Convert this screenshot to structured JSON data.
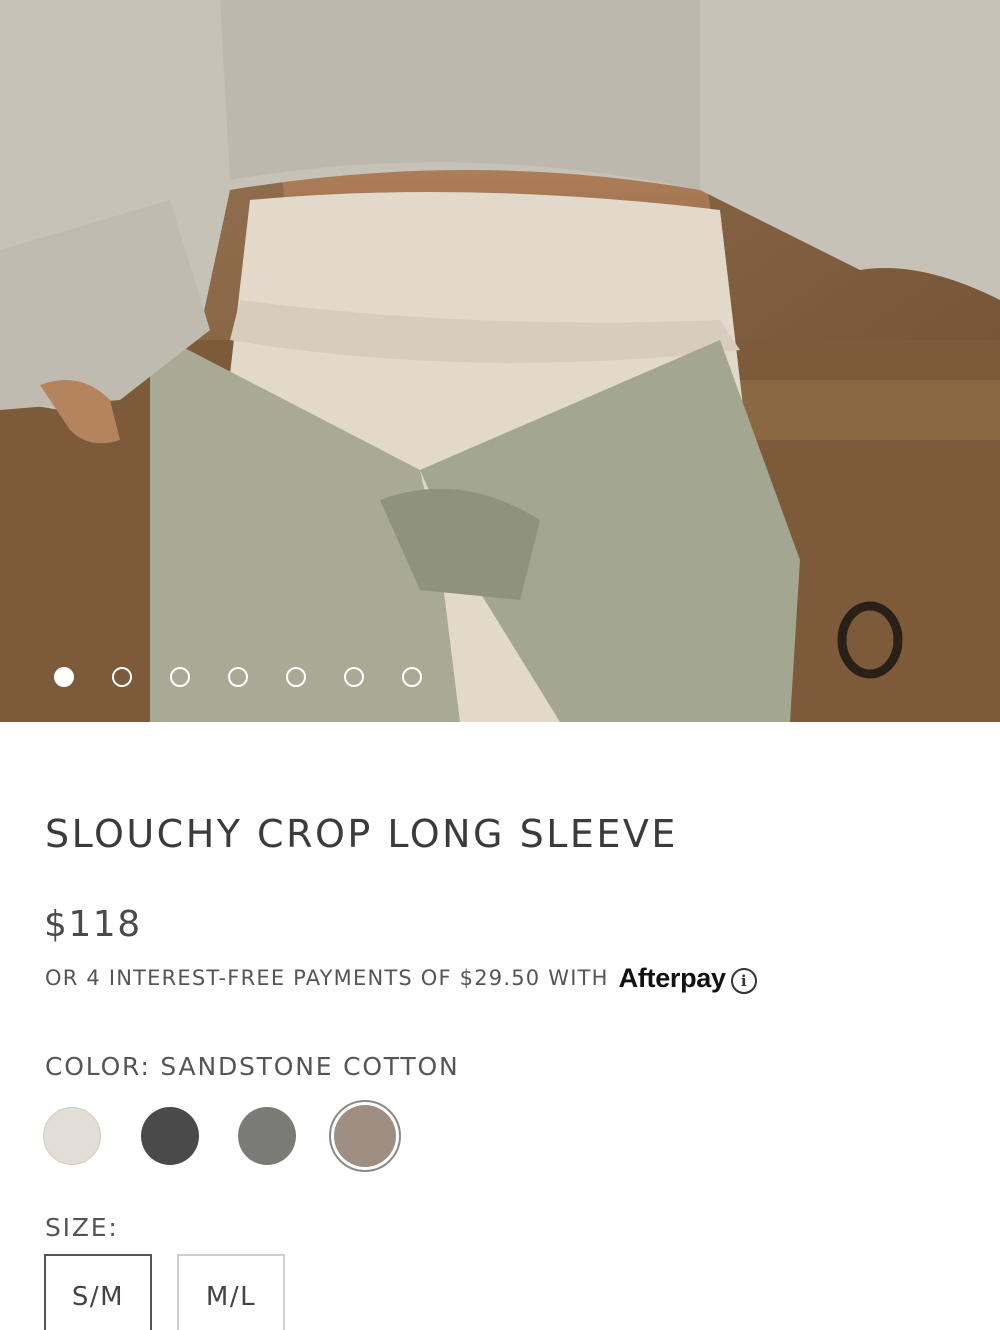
{
  "gallery": {
    "image_alt": "Model wearing slouchy crop long sleeve with leggings and a jacket tied at the waist",
    "slide_count": 7,
    "active_index": 0
  },
  "product": {
    "title": "SLOUCHY CROP LONG SLEEVE",
    "price": "$118",
    "installment_text": "OR 4 INTEREST-FREE PAYMENTS OF $29.50 WITH",
    "afterpay_brand": "Afterpay",
    "info_icon": "i"
  },
  "color": {
    "label": "COLOR: SANDSTONE COTTON",
    "options": [
      {
        "name": "cream",
        "hex": "#e3dfd6"
      },
      {
        "name": "charcoal",
        "hex": "#4a4a4a"
      },
      {
        "name": "grey",
        "hex": "#7a7a76"
      },
      {
        "name": "sandstone",
        "hex": "#9f8f82",
        "selected": true
      }
    ]
  },
  "size": {
    "label": "SIZE:",
    "options": [
      {
        "label": "S/M",
        "selected": true
      },
      {
        "label": "M/L",
        "selected": false
      }
    ]
  }
}
